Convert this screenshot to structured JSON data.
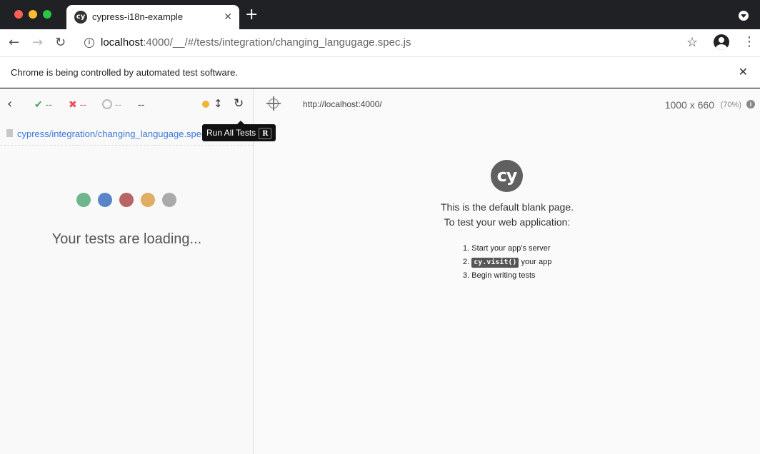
{
  "browser": {
    "tab_title": "cypress-i18n-example",
    "tab_favicon_text": "cy",
    "url_host": "localhost",
    "url_rest": ":4000/__/#/tests/integration/changing_langugage.spec.js",
    "infobar_text": "Chrome is being controlled by automated test software."
  },
  "reporter": {
    "passed": "--",
    "failed": "--",
    "pending": "--",
    "duration": "--",
    "tooltip_label": "Run All Tests",
    "tooltip_shortcut": "R",
    "spec_path": "cypress/integration/changing_langugage.spec.js",
    "loading_text": "Your tests are loading...",
    "loader_colors": [
      "#6fb58d",
      "#5a86c9",
      "#b86565",
      "#e0ae62",
      "#aaaaaa"
    ]
  },
  "aut": {
    "url": "http://localhost:4000/",
    "viewport_size": "1000 x 660",
    "viewport_scale": "(70%)",
    "logo_text": "cy",
    "blank_line_1": "This is the default blank page.",
    "blank_line_2": "To test your web application:",
    "steps": {
      "one_num": "1.",
      "one": "Start your app's server",
      "two_num": "2.",
      "two_code": "cy.visit()",
      "two_rest": "your app",
      "three_num": "3.",
      "three": "Begin writing tests"
    }
  }
}
